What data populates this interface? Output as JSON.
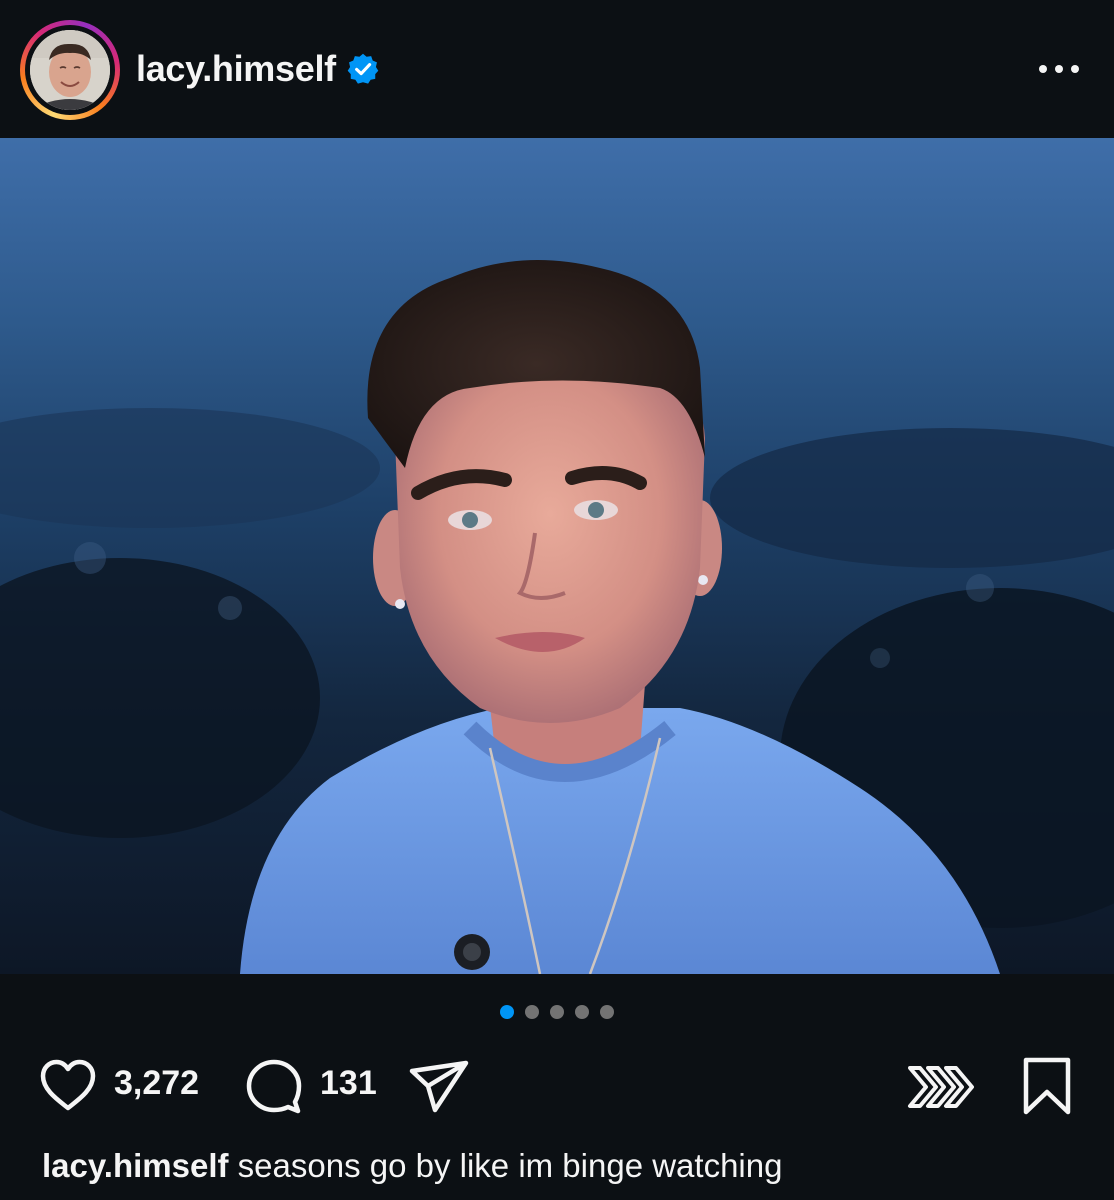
{
  "post": {
    "username": "lacy.himself",
    "verified_icon": "verified-badge-icon",
    "more_icon": "more-horizontal-icon",
    "carousel": {
      "total": 5,
      "active_index": 0
    },
    "actions": {
      "likes": "3,272",
      "comments": "131",
      "like_icon": "heart-icon",
      "comment_icon": "comment-icon",
      "share_icon": "send-icon",
      "remix_icon": "remix-icon",
      "save_icon": "bookmark-icon"
    },
    "caption": {
      "username": "lacy.himself",
      "text": "seasons go by like im binge watching"
    }
  },
  "colors": {
    "background": "#0c1014",
    "text": "#f5f5f5",
    "accent": "#0095f6",
    "dot_inactive": "#737373",
    "shirt": "#6f9fe8"
  }
}
